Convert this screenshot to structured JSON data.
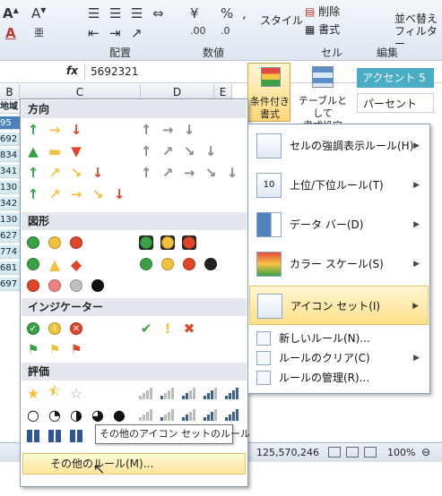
{
  "ribbon": {
    "groups": [
      "配置",
      "数値",
      "セル",
      "編集"
    ],
    "styles_label": "スタイル",
    "delete_label": "削除",
    "format_label": "書式",
    "sort_label": "並べ替え",
    "filter_label": "フィルター",
    "percent": "%",
    "comma": ","
  },
  "formula_bar": {
    "fx": "fx",
    "value": "5692321"
  },
  "columns": [
    "B",
    "C",
    "D",
    "E"
  ],
  "cell_values": [
    "地域",
    "95",
    "692",
    "834",
    "341",
    "130",
    "342",
    "130",
    "627",
    "774",
    "681",
    "697"
  ],
  "cond_format": {
    "line1": "条件付き",
    "line2": "書式"
  },
  "table_format": {
    "line1": "テーブルとして",
    "line2": "書式設定"
  },
  "style_cells": {
    "accent": "アクセント 5",
    "percent": "パーセント"
  },
  "icon_sets": {
    "sections": [
      "方向",
      "図形",
      "インジケーター",
      "評価"
    ],
    "more_icon_sets": "その他のアイコン セットのルール",
    "more_rules": "その他のルール(M)..."
  },
  "menu": {
    "items": [
      "セルの強調表示ルール(H)",
      "上位/下位ルール(T)",
      "データ バー(D)",
      "カラー スケール(S)",
      "アイコン セット(I)"
    ],
    "sub": [
      "新しいルール(N)...",
      "ルールのクリア(C)",
      "ルールの管理(R)..."
    ]
  },
  "status": {
    "sum": "125,570,246",
    "zoom": "100%"
  },
  "colors": {
    "green": "#3aa145",
    "yellow": "#f3c13a",
    "red": "#e0452a",
    "gray": "#8a8a8a",
    "highlight": "#ffe69b"
  }
}
